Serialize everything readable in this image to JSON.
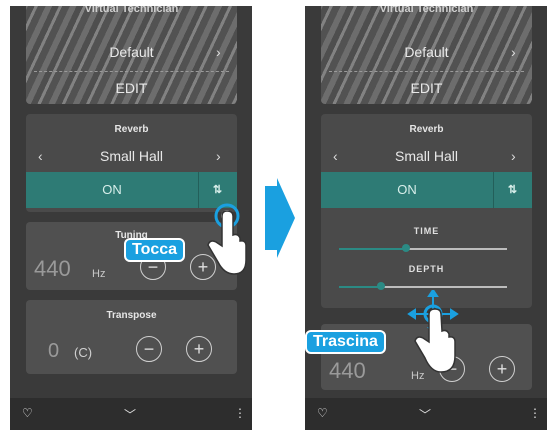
{
  "left": {
    "vt_title": "Virtual Technician",
    "vt_default": "Default",
    "vt_edit": "EDIT",
    "reverb_title": "Reverb",
    "reverb_value": "Small Hall",
    "reverb_state": "ON",
    "tuning_title": "Tuning",
    "tuning_value": "440",
    "tuning_unit": "Hz",
    "transpose_title": "Transpose",
    "transpose_value": "0",
    "transpose_key": "(C)",
    "hint": "Tocca"
  },
  "right": {
    "vt_title": "Virtual Technician",
    "vt_default": "Default",
    "vt_edit": "EDIT",
    "reverb_title": "Reverb",
    "reverb_value": "Small Hall",
    "reverb_state": "ON",
    "time_label": "TIME",
    "depth_label": "DEPTH",
    "time_level": 0.4,
    "depth_level": 0.25,
    "tuning_partial": "g",
    "tuning_value": "440",
    "tuning_unit": "Hz",
    "hint": "Trascina"
  },
  "icons": {
    "prev": "‹",
    "next": "›",
    "equalizer": "⇅",
    "minus": "−",
    "plus": "+",
    "heart": "♡",
    "chevron_down": "﹀",
    "more": "⋮"
  },
  "colors": {
    "accent": "#2e7b75",
    "hint_bg": "#1aa0e0",
    "arrow": "#1aa0e0"
  }
}
